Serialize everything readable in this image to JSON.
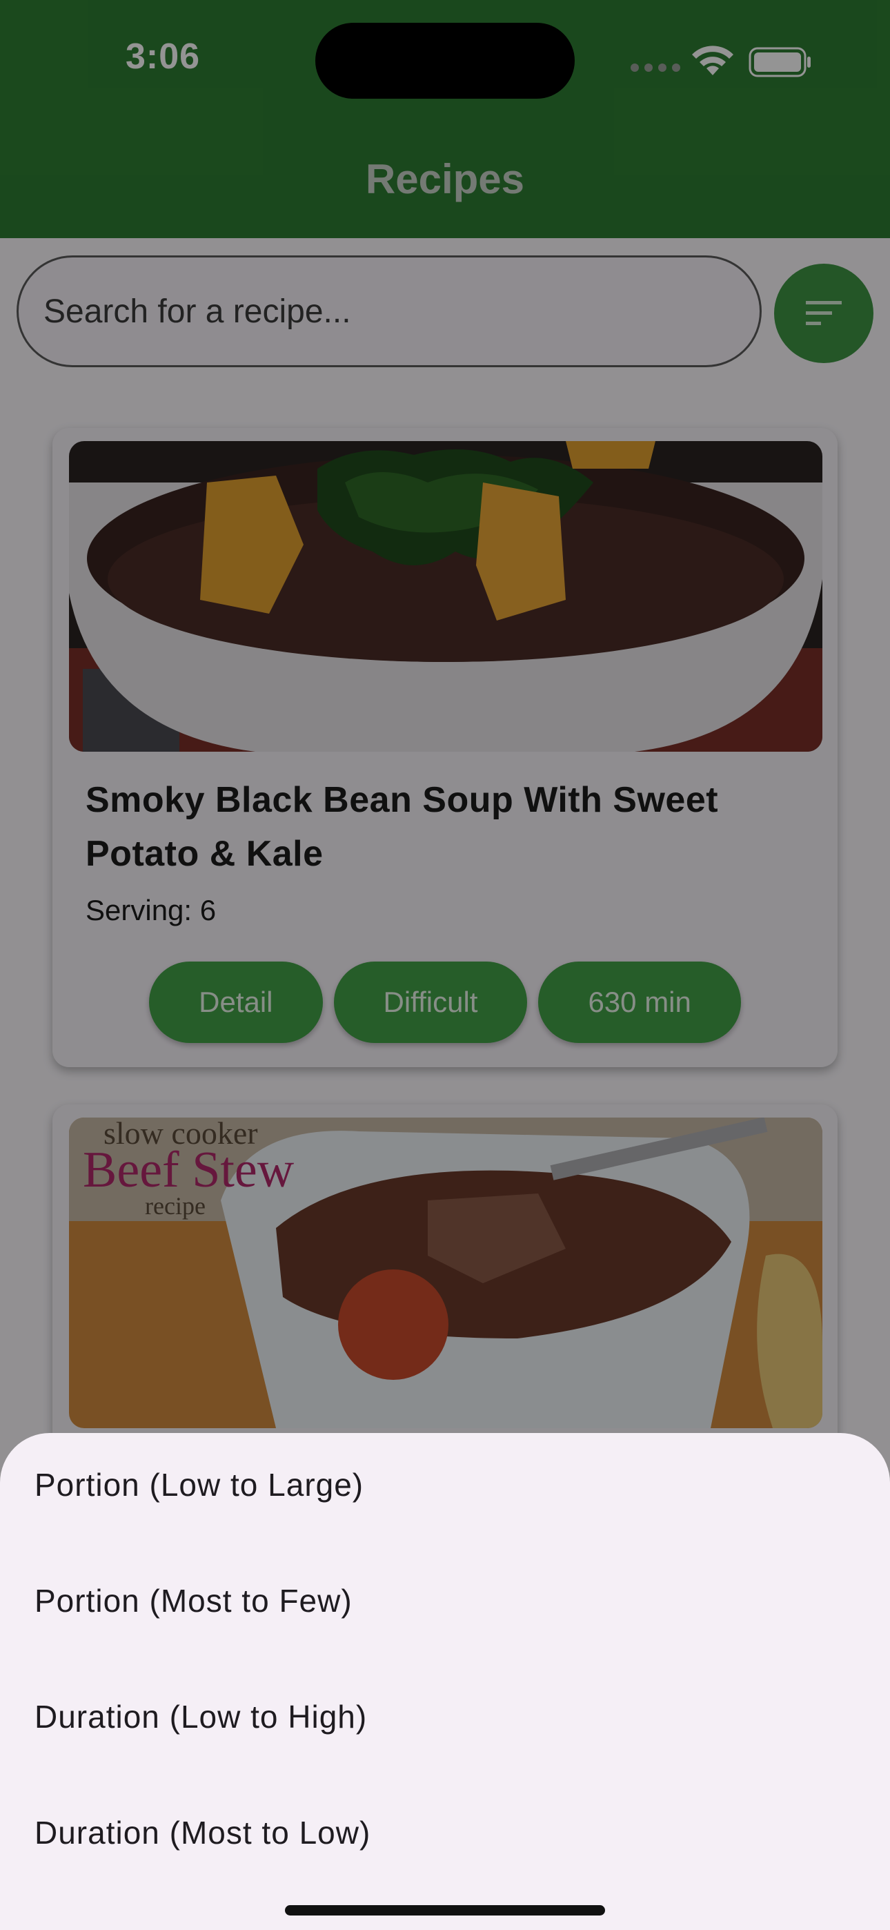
{
  "status_bar": {
    "time": "3:06"
  },
  "app_bar": {
    "title": "Recipes"
  },
  "search": {
    "placeholder": "Search for a recipe..."
  },
  "filter_button": {
    "icon": "sort-icon"
  },
  "recipes": [
    {
      "title": "Smoky Black Bean Soup With Sweet Potato & Kale",
      "serving": "Serving: 6",
      "detail_label": "Detail",
      "difficulty": "Difficult",
      "duration": "630 min"
    },
    {
      "image_text": [
        "slow cooker",
        "Beef Stew",
        "recipe"
      ]
    }
  ],
  "sort_sheet": {
    "options": [
      "Portion (Low to Large)",
      "Portion (Most to Few)",
      "Duration (Low to High)",
      "Duration (Most to Low)"
    ]
  },
  "colors": {
    "primary": "#2e7d32",
    "button": "#43a047",
    "sheet": "#f5eff6"
  }
}
